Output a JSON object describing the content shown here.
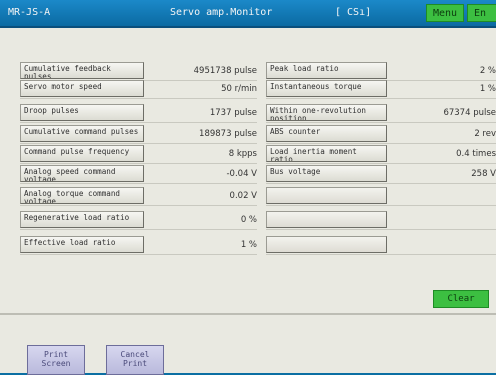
{
  "titlebar": {
    "station": "MR-JS-A",
    "title": "Servo amp.Monitor",
    "mode": "[ CSı]",
    "menu_label": "Menu",
    "end_label": "En"
  },
  "params_left": [
    {
      "label": "Cumulative feedback pulses",
      "value": "4951738 pulse"
    },
    {
      "label": "Servo motor speed",
      "value": "50 r/min"
    },
    {
      "label": "Droop pulses",
      "value": "1737 pulse"
    },
    {
      "label": "Cumulative command pulses",
      "value": "189873 pulse"
    },
    {
      "label": "Command pulse frequency",
      "value": "8 kpps"
    },
    {
      "label": "Analog speed command voltage",
      "value": "-0.04 V"
    },
    {
      "label": "Analog torque command voltage",
      "value": "0.02 V"
    },
    {
      "label": "Regenerative load ratio",
      "value": "0 %"
    },
    {
      "label": "Effective load ratio",
      "value": "1 %"
    }
  ],
  "params_right": [
    {
      "label": "Peak load ratio",
      "value": "2 %"
    },
    {
      "label": "Instantaneous torque",
      "value": "1 %"
    },
    {
      "label": "Within one-revolution position",
      "value": "67374 pulse"
    },
    {
      "label": "ABS counter",
      "value": "2 rev"
    },
    {
      "label": "Load inertia moment ratio",
      "value": "0.4 times"
    },
    {
      "label": "Bus voltage",
      "value": "258 V"
    },
    {
      "label": "",
      "value": ""
    },
    {
      "label": "",
      "value": ""
    },
    {
      "label": "",
      "value": ""
    }
  ],
  "clear_label": "Clear",
  "print_screen_label": "Print Screen",
  "cancel_print_label": "Cancel Print"
}
